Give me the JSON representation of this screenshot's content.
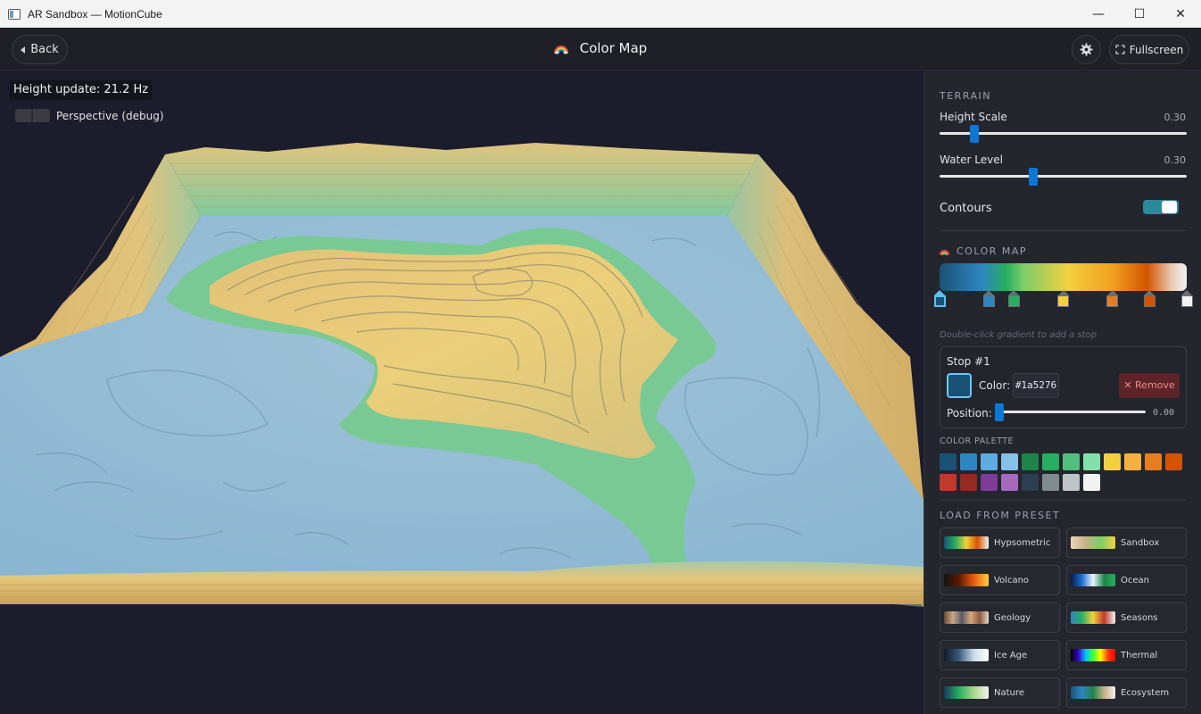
{
  "window": {
    "title": "AR Sandbox — MotionCube",
    "minimize": "—",
    "maximize": "☐",
    "close": "✕"
  },
  "header": {
    "back_label": "Back",
    "page_title": "Color Map",
    "fullscreen_label": "Fullscreen"
  },
  "viewport": {
    "height_update": "Height update: 21.2 Hz",
    "perspective_label": "Perspective (debug)"
  },
  "terrain": {
    "section_title": "TERRAIN",
    "height_scale": {
      "label": "Height Scale",
      "value": "0.30",
      "fraction": 0.14
    },
    "water_level": {
      "label": "Water Level",
      "value": "0.30",
      "fraction": 0.38
    },
    "contours_label": "Contours",
    "contours_on": true
  },
  "color_map": {
    "section_title": "COLOR MAP",
    "stops": [
      {
        "color": "#1a5276",
        "position": 0.0,
        "selected": true
      },
      {
        "color": "#2e86c1",
        "position": 0.2
      },
      {
        "color": "#27ae60",
        "position": 0.3
      },
      {
        "color": "#f4d03f",
        "position": 0.5
      },
      {
        "color": "#e67e22",
        "position": 0.7
      },
      {
        "color": "#d35400",
        "position": 0.85
      },
      {
        "color": "#f2f2f2",
        "position": 1.0
      }
    ],
    "hint": "Double-click gradient to add a stop",
    "editor": {
      "title": "Stop #1",
      "color_label": "Color:",
      "hex": "#1a5276",
      "remove_label": "✕ Remove",
      "position_label": "Position:",
      "position_value": "0.00"
    }
  },
  "palette": {
    "title": "COLOR PALETTE",
    "colors": [
      "#1a5276",
      "#2e86c1",
      "#5dade2",
      "#85c1e9",
      "#1e8449",
      "#27ae60",
      "#52be80",
      "#82e0aa",
      "#f4d03f",
      "#f5b041",
      "#e67e22",
      "#d35400",
      "#c0392b",
      "#922b21",
      "#7d3c98",
      "#a569bd",
      "#2c3e50",
      "#7f8c8d",
      "#bdc3c7",
      "#f2f2f2"
    ]
  },
  "presets": {
    "title": "LOAD FROM PRESET",
    "items": [
      {
        "label": "Hypsometric",
        "gradient": [
          "#1a5276",
          "#27ae60",
          "#f4d03f",
          "#d35400",
          "#f2f2f2"
        ]
      },
      {
        "label": "Sandbox",
        "gradient": [
          "#e8d8b8",
          "#c8b088",
          "#7dce6a",
          "#f4d03f"
        ]
      },
      {
        "label": "Volcano",
        "gradient": [
          "#111111",
          "#5a1a00",
          "#e85a10",
          "#ffd040"
        ]
      },
      {
        "label": "Ocean",
        "gradient": [
          "#0a1a4a",
          "#1e6fd0",
          "#e8f4ff",
          "#1e8449",
          "#27ae60"
        ]
      },
      {
        "label": "Geology",
        "gradient": [
          "#6b4a30",
          "#c8a888",
          "#5a5a6a",
          "#d8a878",
          "#8a5a40",
          "#e8d8c8"
        ]
      },
      {
        "label": "Seasons",
        "gradient": [
          "#2e86c1",
          "#27ae60",
          "#f4d03f",
          "#c0392b",
          "#f2f2f2"
        ]
      },
      {
        "label": "Ice Age",
        "gradient": [
          "#0f1a2a",
          "#3a5a7a",
          "#c8dce8",
          "#ffffff"
        ]
      },
      {
        "label": "Thermal",
        "gradient": [
          "#000000",
          "#3a00c0",
          "#00c0ff",
          "#40ff40",
          "#ffff00",
          "#ff4000",
          "#ff0000"
        ]
      },
      {
        "label": "Nature",
        "gradient": [
          "#1a3a5a",
          "#27ae60",
          "#a8d888",
          "#f2f2f2"
        ]
      },
      {
        "label": "Ecosystem",
        "gradient": [
          "#1a5276",
          "#2e86c1",
          "#1e8449",
          "#c8b088",
          "#f2f2f2"
        ]
      }
    ]
  }
}
